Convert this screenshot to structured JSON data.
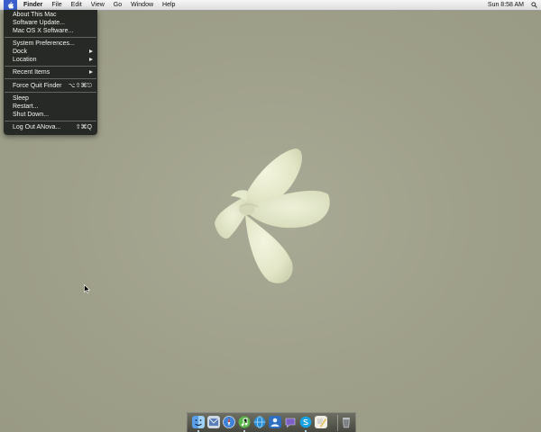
{
  "menubar": {
    "app_name": "Finder",
    "menus": [
      "File",
      "Edit",
      "View",
      "Go",
      "Window",
      "Help"
    ],
    "clock": "Sun 8:58 AM",
    "apple_icon": "apple-icon",
    "spotlight_icon": "magnifier-icon"
  },
  "apple_menu": {
    "items": [
      {
        "label": "About This Mac"
      },
      {
        "label": "Software Update..."
      },
      {
        "label": "Mac OS X Software..."
      },
      {
        "label": "System Preferences..."
      },
      {
        "label": "Dock"
      },
      {
        "label": "Location"
      },
      {
        "label": "Recent Items"
      },
      {
        "label": "Force Quit Finder",
        "shortcut": "⌥⇧⌘⎋"
      },
      {
        "label": "Sleep"
      },
      {
        "label": "Restart..."
      },
      {
        "label": "Shut Down..."
      },
      {
        "label": "Log Out ANova...",
        "shortcut": "⇧⌘Q"
      }
    ]
  },
  "dock": {
    "items": [
      {
        "icon": "finder-icon",
        "running": true
      },
      {
        "icon": "mail-icon",
        "running": false
      },
      {
        "icon": "safari-icon",
        "running": false
      },
      {
        "icon": "itunes-icon",
        "running": true
      },
      {
        "icon": "network-icon",
        "running": false
      },
      {
        "icon": "user-icon",
        "running": false
      },
      {
        "icon": "ichat-icon",
        "running": false
      },
      {
        "icon": "skype-icon",
        "running": true
      },
      {
        "icon": "textedit-icon",
        "running": false
      },
      {
        "icon": "trash-icon",
        "running": false
      }
    ]
  },
  "colors": {
    "desktop": "#9fa08a",
    "menu_highlight": "#3a5fcd",
    "menu_background": "#1e201e",
    "flower": "#e8eccf"
  }
}
